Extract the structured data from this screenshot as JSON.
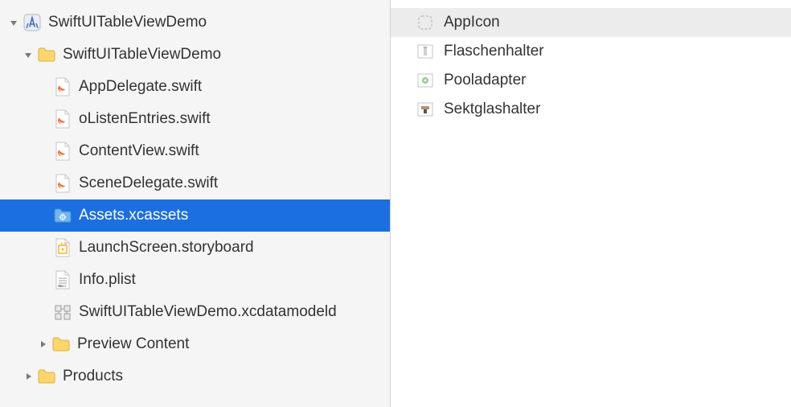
{
  "navigator": {
    "project": {
      "name": "SwiftUITableViewDemo",
      "expanded": true
    },
    "children": [
      {
        "type": "group",
        "name": "SwiftUITableViewDemo",
        "expanded": true,
        "children": [
          {
            "type": "swift",
            "name": "AppDelegate.swift"
          },
          {
            "type": "swift",
            "name": "oListenEntries.swift"
          },
          {
            "type": "swift",
            "name": "ContentView.swift"
          },
          {
            "type": "swift",
            "name": "SceneDelegate.swift"
          },
          {
            "type": "xcassets",
            "name": "Assets.xcassets",
            "selected": true
          },
          {
            "type": "storyboard",
            "name": "LaunchScreen.storyboard"
          },
          {
            "type": "plist",
            "name": "Info.plist"
          },
          {
            "type": "coredata",
            "name": "SwiftUITableViewDemo.xcdatamodeld"
          },
          {
            "type": "group",
            "name": "Preview Content",
            "expanded": false
          }
        ]
      },
      {
        "type": "group",
        "name": "Products",
        "expanded": false
      }
    ]
  },
  "assets": [
    {
      "name": "AppIcon",
      "kind": "appicon",
      "selected": true
    },
    {
      "name": "Flaschenhalter",
      "kind": "image"
    },
    {
      "name": "Pooladapter",
      "kind": "image"
    },
    {
      "name": "Sektglashalter",
      "kind": "image"
    }
  ]
}
